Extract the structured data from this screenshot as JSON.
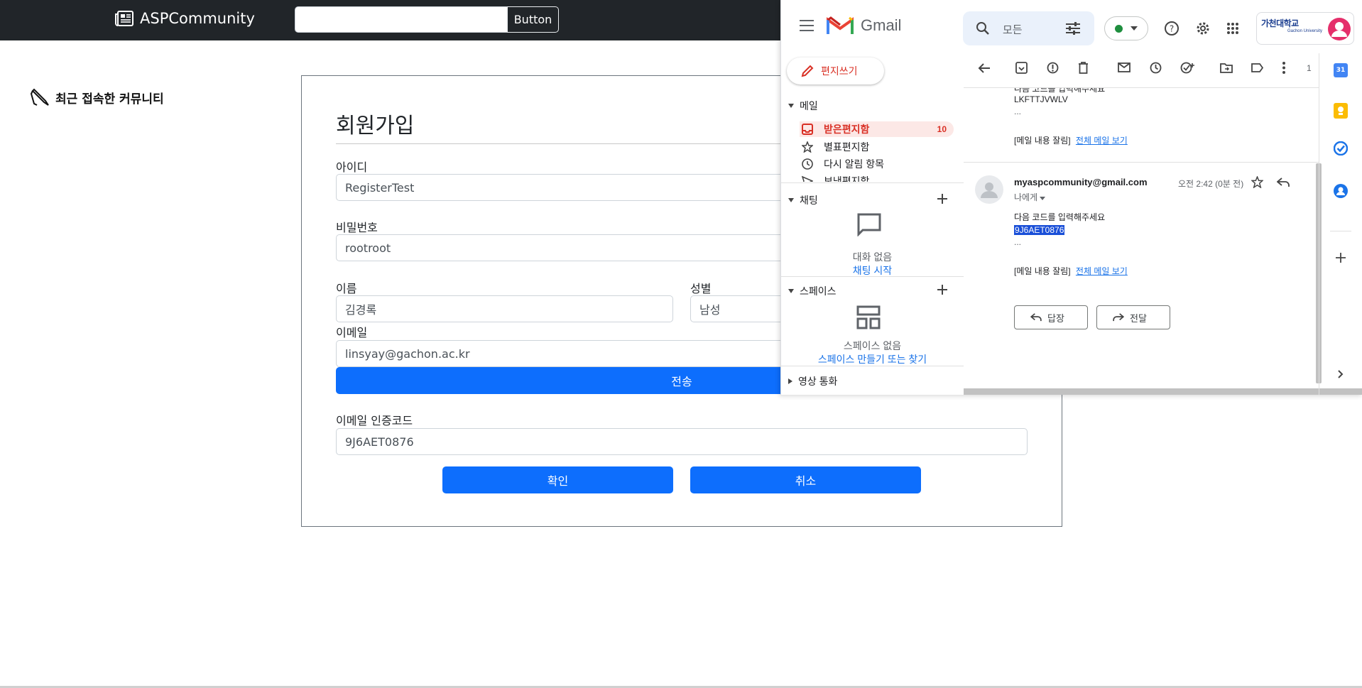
{
  "navbar": {
    "brand": "ASPCommunity",
    "search_value": "",
    "button_label": "Button"
  },
  "recent": {
    "title": "최근 접속한 커뮤니티"
  },
  "register": {
    "title": "회원가입",
    "id_label": "아이디",
    "id_value": "RegisterTest",
    "pw_label": "비밀번호",
    "pw_value": "rootroot",
    "name_label": "이름",
    "name_value": "김경록",
    "gender_label": "성별",
    "gender_value": "남성",
    "email_label": "이메일",
    "email_value": "linsyay@gachon.ac.kr",
    "send_label": "전송",
    "code_label": "이메일 인증코드",
    "code_value": "9J6AET0876",
    "confirm_label": "확인",
    "cancel_label": "취소"
  },
  "gmail": {
    "logo_text": "Gmail",
    "search_placeholder": "모든",
    "compose": "편지쓰기",
    "section_mail": "메일",
    "items": [
      {
        "label": "받은편지함",
        "count": "10"
      },
      {
        "label": "별표편지함"
      },
      {
        "label": "다시 알림 항목"
      },
      {
        "label": "보낸편지함"
      }
    ],
    "section_chat": "채팅",
    "chat_empty": "대화 없음",
    "chat_start": "채팅 시작",
    "section_spaces": "스페이스",
    "spaces_empty": "스페이스 없음",
    "spaces_link": "스페이스 만들기 또는 찾기",
    "section_video": "영상 통화",
    "page_count": "1",
    "prev_message": {
      "line1": "다음 코드를 입력해주세요",
      "code": "LKFTTJVWLV",
      "ellipsis": "...",
      "clip": "[메일 내용 잘림]",
      "view_all": "전체 메일 보기"
    },
    "message": {
      "from": "myaspcommunity@gmail.com",
      "time": "오전 2:42 (0분 전)",
      "to": "나에게",
      "line1": "다음 코드를 입력해주세요",
      "code": "9J6AET0876",
      "ellipsis": "...",
      "clip": "[메일 내용 잘림]",
      "view_all": "전체 메일 보기"
    },
    "reply": "답장",
    "forward": "전달",
    "org_logo_text": "가천대학교",
    "org_logo_sub": "Gachon University",
    "calendar_day": "31",
    "accent": "#d93025",
    "link_color": "#1a73e8"
  }
}
